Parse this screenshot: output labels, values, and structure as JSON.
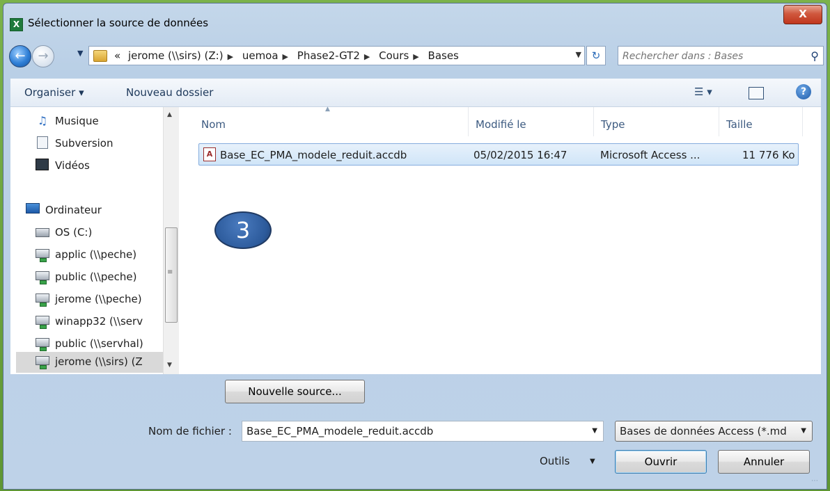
{
  "window": {
    "title": "Sélectionner la source de données",
    "app_icon": "X",
    "close_label": "X"
  },
  "address": {
    "crumbs": [
      "jerome (\\\\sirs) (Z:)",
      "uemoa",
      "Phase2-GT2",
      "Cours",
      "Bases"
    ],
    "overflow_label": "«",
    "search_placeholder": "Rechercher dans : Bases"
  },
  "toolbar": {
    "organize_label": "Organiser ▾",
    "new_folder_label": "Nouveau dossier"
  },
  "nav": {
    "items": [
      {
        "label": "Musique",
        "icon": "music-icon"
      },
      {
        "label": "Subversion",
        "icon": "document-icon"
      },
      {
        "label": "Vidéos",
        "icon": "video-icon"
      },
      {
        "label": "Ordinateur",
        "icon": "computer-icon"
      },
      {
        "label": "OS (C:)",
        "icon": "drive-icon"
      },
      {
        "label": "applic (\\\\peche)",
        "icon": "network-drive-icon"
      },
      {
        "label": "public (\\\\peche)",
        "icon": "network-drive-icon"
      },
      {
        "label": "jerome (\\\\peche)",
        "icon": "network-drive-icon"
      },
      {
        "label": "winapp32 (\\\\serv",
        "icon": "network-drive-icon"
      },
      {
        "label": "public (\\\\servhal)",
        "icon": "network-drive-icon"
      },
      {
        "label": "jerome (\\\\sirs) (Z",
        "icon": "network-drive-icon"
      }
    ]
  },
  "columns": {
    "name": "Nom",
    "modified": "Modifié le",
    "type": "Type",
    "size": "Taille"
  },
  "files": [
    {
      "name": "Base_EC_PMA_modele_reduit.accdb",
      "modified": "05/02/2015 16:47",
      "type": "Microsoft Access ...",
      "size": "11 776 Ko"
    }
  ],
  "overlay": {
    "step_number": "3"
  },
  "buttons": {
    "new_source": "Nouvelle source...",
    "open": "Ouvrir",
    "cancel": "Annuler",
    "tools": "Outils"
  },
  "filename": {
    "label": "Nom de fichier :",
    "value": "Base_EC_PMA_modele_reduit.accdb"
  },
  "filter": {
    "selected": "Bases de données Access (*.md"
  },
  "colors": {
    "selection": "#d0e5f8",
    "close_button": "#c0361d",
    "step_badge": "#2c5a9b",
    "excel_green": "#1f7a3c"
  }
}
